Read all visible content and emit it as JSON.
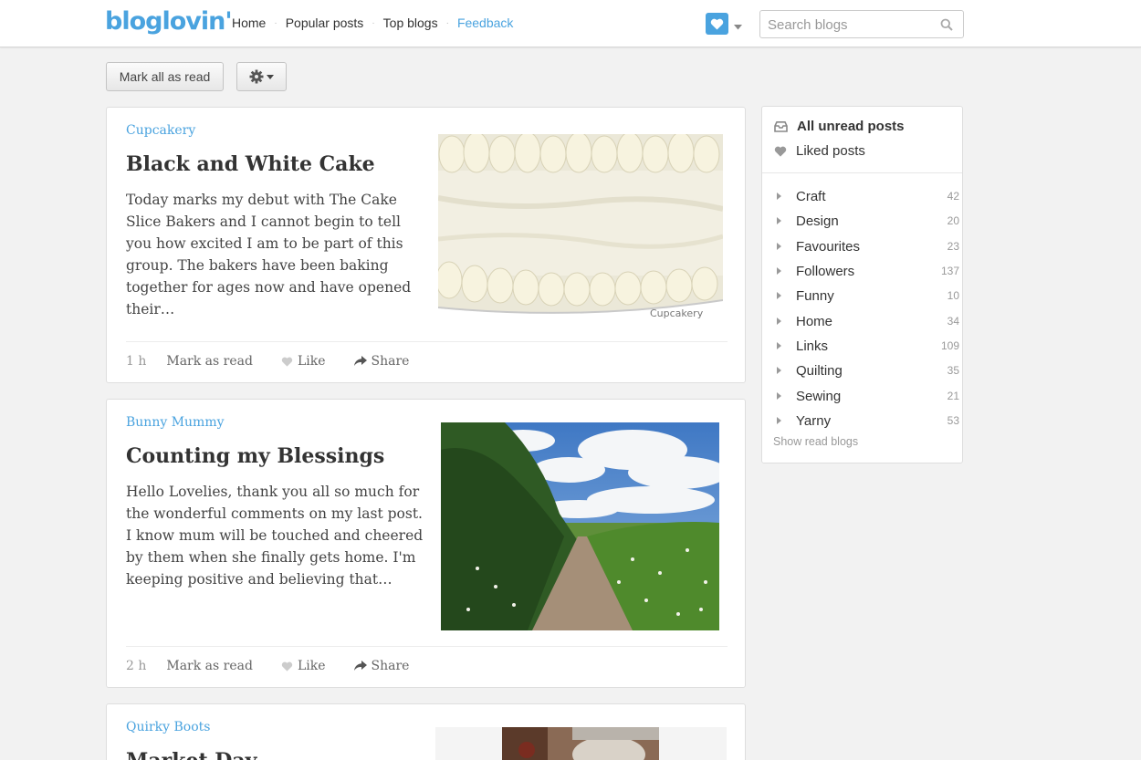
{
  "header": {
    "logo": "bloglovin'",
    "nav": [
      "Home",
      "Popular posts",
      "Top blogs",
      "Feedback"
    ],
    "search_placeholder": "Search blogs"
  },
  "toolbar": {
    "mark_all_label": "Mark all as read"
  },
  "posts": [
    {
      "blog": "Cupcakery",
      "title": "Black and White Cake",
      "excerpt": "Today marks my debut with The Cake Slice Bakers and I cannot begin to tell you how excited I am to be part of this group. The bakers have been baking together for ages now and have opened their…",
      "watermark": "Cupcakery",
      "time": "1 h",
      "mark_label": "Mark as read",
      "like_label": "Like",
      "share_label": "Share"
    },
    {
      "blog": "Bunny Mummy",
      "title": "Counting my Blessings",
      "excerpt": "Hello Lovelies, thank you all so much for the wonderful comments on my last post. I know mum will be touched and cheered by them when she finally gets home.  I'm keeping positive and believing that…",
      "time": "2 h",
      "mark_label": "Mark as read",
      "like_label": "Like",
      "share_label": "Share"
    },
    {
      "blog": "Quirky Boots",
      "title": "Market Day"
    }
  ],
  "sidebar": {
    "all_unread": "All unread posts",
    "liked": "Liked posts",
    "categories": [
      {
        "name": "Craft",
        "count": "42"
      },
      {
        "name": "Design",
        "count": "20"
      },
      {
        "name": "Favourites",
        "count": "23"
      },
      {
        "name": "Followers",
        "count": "137"
      },
      {
        "name": "Funny",
        "count": "10"
      },
      {
        "name": "Home",
        "count": "34"
      },
      {
        "name": "Links",
        "count": "109"
      },
      {
        "name": "Quilting",
        "count": "35"
      },
      {
        "name": "Sewing",
        "count": "21"
      },
      {
        "name": "Yarny",
        "count": "53"
      }
    ],
    "show_read": "Show read blogs"
  },
  "colors": {
    "brand": "#4aa3df",
    "background": "#f2f2f2"
  },
  "icons": [
    "heart-icon",
    "caret-down-icon",
    "search-icon",
    "gear-icon",
    "like-heart-icon",
    "share-arrow-icon",
    "inbox-icon",
    "triangle-right-icon"
  ]
}
